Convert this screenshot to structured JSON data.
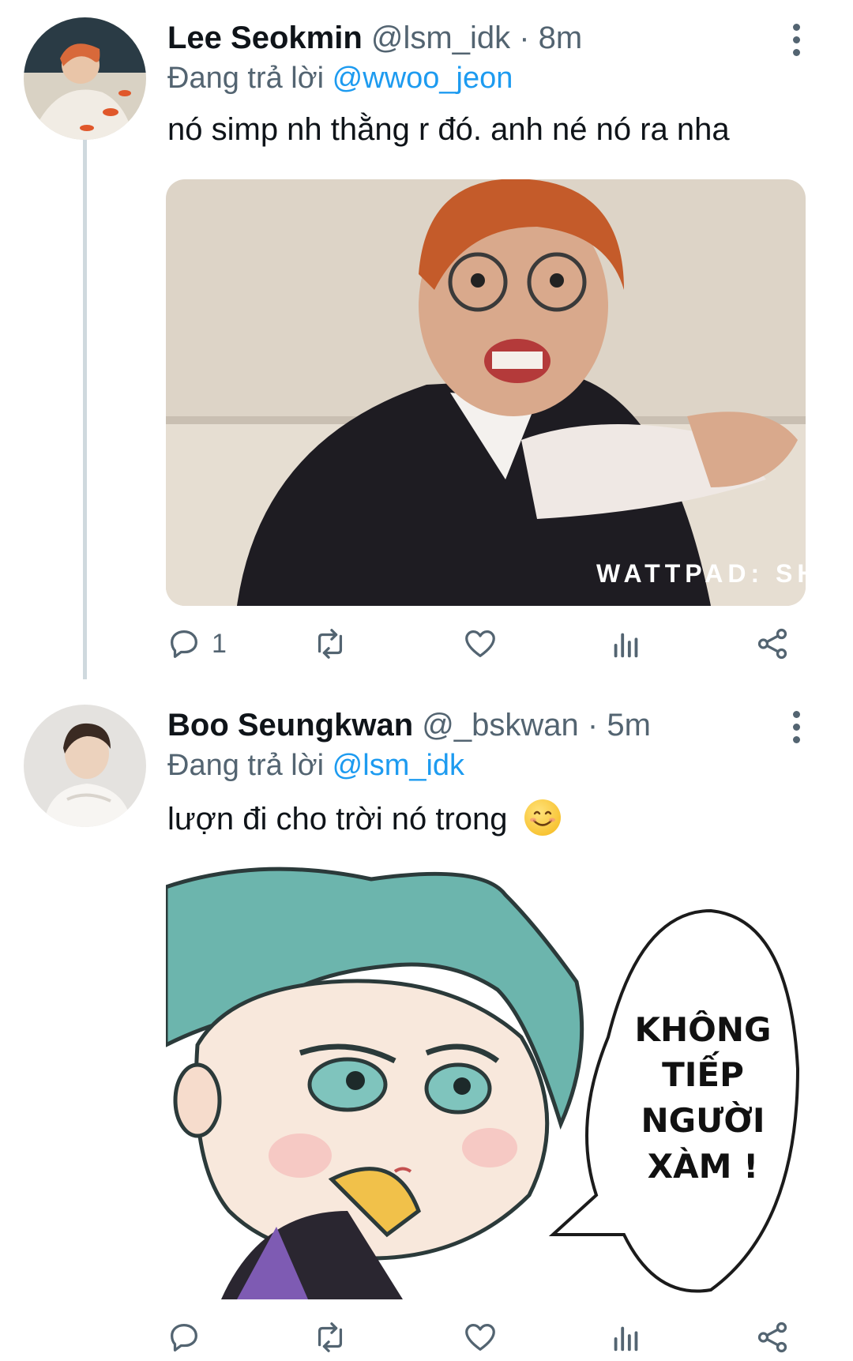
{
  "tweets": [
    {
      "name": "Lee Seokmin",
      "handle": "@lsm_idk",
      "separator": "·",
      "time": "8m",
      "reply_prefix": "Đang trả lời",
      "reply_to": "@wwoo_jeon",
      "text": "nó simp nh thằng r đó. anh né nó ra nha",
      "media_watermark": "WATTPAD: SHORT-CA",
      "reply_count": "1"
    },
    {
      "name": "Boo Seungkwan",
      "handle": "@_bskwan",
      "separator": "·",
      "time": "5m",
      "reply_prefix": "Đang trả lời",
      "reply_to": "@lsm_idk",
      "text": "lượn đi cho trời nó trong",
      "emoji": "smiling-face",
      "speech_lines": [
        "KHÔNG",
        "TIẾP",
        "NGƯỜI",
        "XÀM !"
      ]
    }
  ],
  "colors": {
    "text": "#0f1419",
    "secondary": "#536471",
    "accent": "#1d9bf0",
    "thread_line": "#cfd9de"
  },
  "icons": [
    "reply-icon",
    "retweet-icon",
    "like-icon",
    "views-icon",
    "share-icon",
    "more-icon"
  ]
}
